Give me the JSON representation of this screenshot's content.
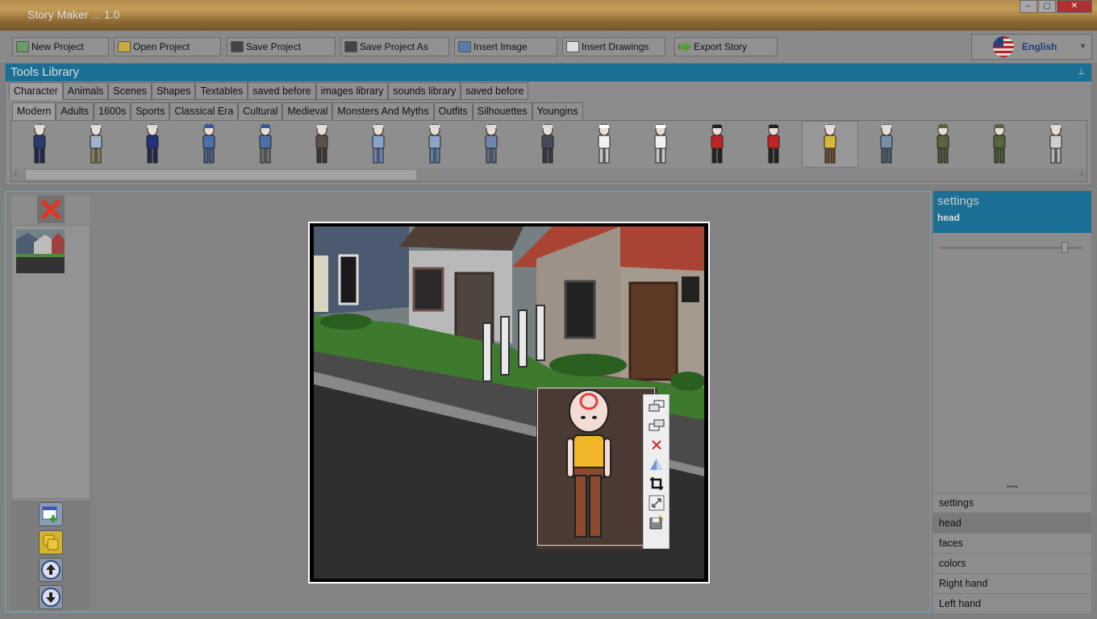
{
  "window": {
    "title": "Story Maker ... 1.0"
  },
  "toolbar": {
    "new_project": "New Project",
    "open_project": "Open Project",
    "save_project": "Save Project",
    "save_project_as": "Save Project As",
    "insert_image": "Insert Image",
    "insert_drawings": "Insert Drawings",
    "export_story": "Export Story"
  },
  "language": {
    "selected": "English"
  },
  "library": {
    "title": "Tools Library",
    "tabs": [
      "Character",
      "Animals",
      "Scenes",
      "Shapes",
      "Textables",
      "saved before",
      "images library",
      "sounds library",
      "saved before"
    ],
    "subtabs": [
      "Modern",
      "Adults",
      "1600s",
      "Sports",
      "Classical Era",
      "Cultural",
      "Medieval",
      "Monsters And Myths",
      "Outfits",
      "Silhouettes",
      "Youngins"
    ],
    "characters": [
      {
        "shirt": "#2c3b6e",
        "pants": "#20284f",
        "hair": "#dcdcdc"
      },
      {
        "shirt": "#9fb4cc",
        "pants": "#8f8060",
        "hair": "#dcdcdc"
      },
      {
        "shirt": "#23307a",
        "pants": "#20284f",
        "hair": "#dcdcdc"
      },
      {
        "shirt": "#4d6fa8",
        "pants": "#46608f",
        "hair": "#3b56a0"
      },
      {
        "shirt": "#4d6fa8",
        "pants": "#6e6e6e",
        "hair": "#3b56a0"
      },
      {
        "shirt": "#5d5048",
        "pants": "#3e3630",
        "hair": "#dcdcdc"
      },
      {
        "shirt": "#8aa3c8",
        "pants": "#6b86b8",
        "hair": "#dcdcdc"
      },
      {
        "shirt": "#8aa3c8",
        "pants": "#5d7dae",
        "hair": "#dcdcdc"
      },
      {
        "shirt": "#7288aa",
        "pants": "#5e6b80",
        "hair": "#dcdcdc"
      },
      {
        "shirt": "#444a58",
        "pants": "#353a45",
        "hair": "#dcdcdc"
      },
      {
        "shirt": "#f0f0f0",
        "pants": "#c8c8c8",
        "hair": "#ffffff"
      },
      {
        "shirt": "#f0f0f0",
        "pants": "#c8c8c8",
        "hair": "#ffffff"
      },
      {
        "shirt": "#c02525",
        "pants": "#222222",
        "hair": "#222222"
      },
      {
        "shirt": "#c02525",
        "pants": "#222222",
        "hair": "#222222"
      },
      {
        "shirt": "#d8b83a",
        "pants": "#6b4a2e",
        "hair": "#dcdcdc"
      },
      {
        "shirt": "#7a8ea8",
        "pants": "#4d5b70",
        "hair": "#dcdcdc"
      },
      {
        "shirt": "#56653e",
        "pants": "#4a5636",
        "hair": "#56653e"
      },
      {
        "shirt": "#56653e",
        "pants": "#4a5636",
        "hair": "#56653e"
      },
      {
        "shirt": "#cfcfcf",
        "pants": "#b5b5b5",
        "hair": "#dcdcdc"
      }
    ]
  },
  "settings": {
    "title": "settings",
    "selected_part": "head",
    "slider_level": 0.9,
    "items": [
      "settings",
      "head",
      "faces",
      "colors",
      "Right hand",
      "Left hand"
    ]
  },
  "colors": {
    "accent": "#1b6f94",
    "sky": "#7a8d91",
    "road": "#2e2e2e"
  }
}
